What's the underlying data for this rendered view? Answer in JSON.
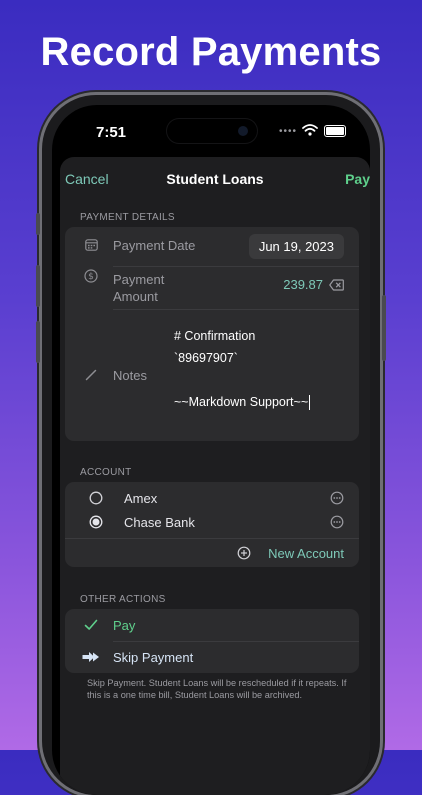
{
  "headline": "Record Payments",
  "status_bar": {
    "time": "7:51",
    "signal": "••••"
  },
  "nav": {
    "cancel_label": "Cancel",
    "title": "Student Loans",
    "pay_label": "Pay"
  },
  "payment_details": {
    "section_label": "PAYMENT DETAILS",
    "date_label": "Payment Date",
    "date_value": "Jun 19, 2023",
    "amount_label_line1": "Payment",
    "amount_label_line2": "Amount",
    "amount_value": "239.87",
    "notes_label": "Notes",
    "notes_lines": [
      "# Confirmation",
      "`89697907`",
      "~~Markdown Support~~"
    ]
  },
  "account": {
    "section_label": "ACCOUNT",
    "items": [
      {
        "name": "Amex",
        "selected": false
      },
      {
        "name": "Chase Bank",
        "selected": true
      }
    ],
    "new_account_label": "New Account"
  },
  "other_actions": {
    "section_label": "OTHER ACTIONS",
    "items": [
      {
        "label": "Pay",
        "icon": "checkmark-icon"
      },
      {
        "label": "Skip Payment",
        "icon": "skip-arrow-icon"
      }
    ],
    "footnote": "Skip Payment. Student Loans will be rescheduled if it repeats. If this is a one time bill, Student Loans will be archived."
  },
  "colors": {
    "accent_teal": "#7ec9b8",
    "accent_green": "#5fd08c",
    "card": "#2c2c2e",
    "sheet": "#1e1e20"
  }
}
